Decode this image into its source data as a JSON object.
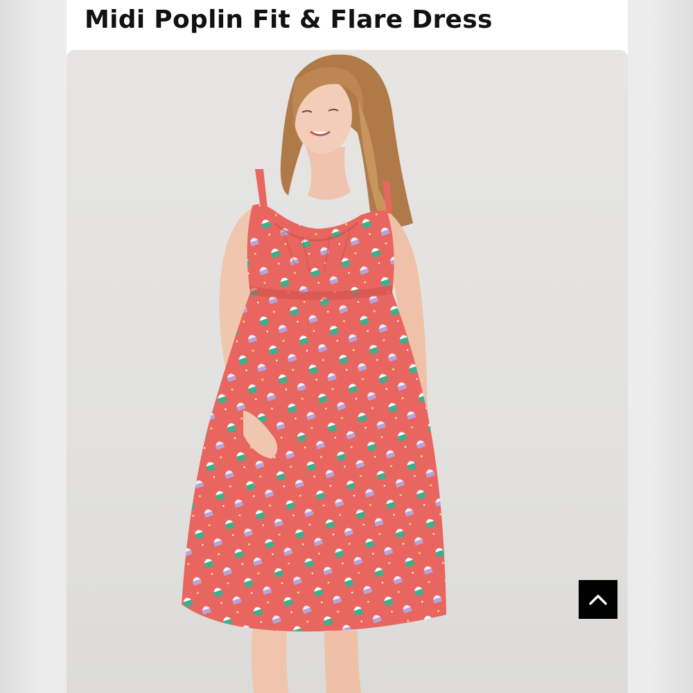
{
  "product": {
    "title": "Midi Poplin Fit & Flare Dress",
    "image_alt": "Woman wearing a coral cupcake print midi fit and flare dress"
  },
  "colors": {
    "dress": "#e8665f",
    "print_mint": "#3fae8c",
    "print_lilac": "#b7a3d8",
    "button": "#000000"
  },
  "controls": {
    "back_to_top_icon": "chevron-up-icon"
  }
}
